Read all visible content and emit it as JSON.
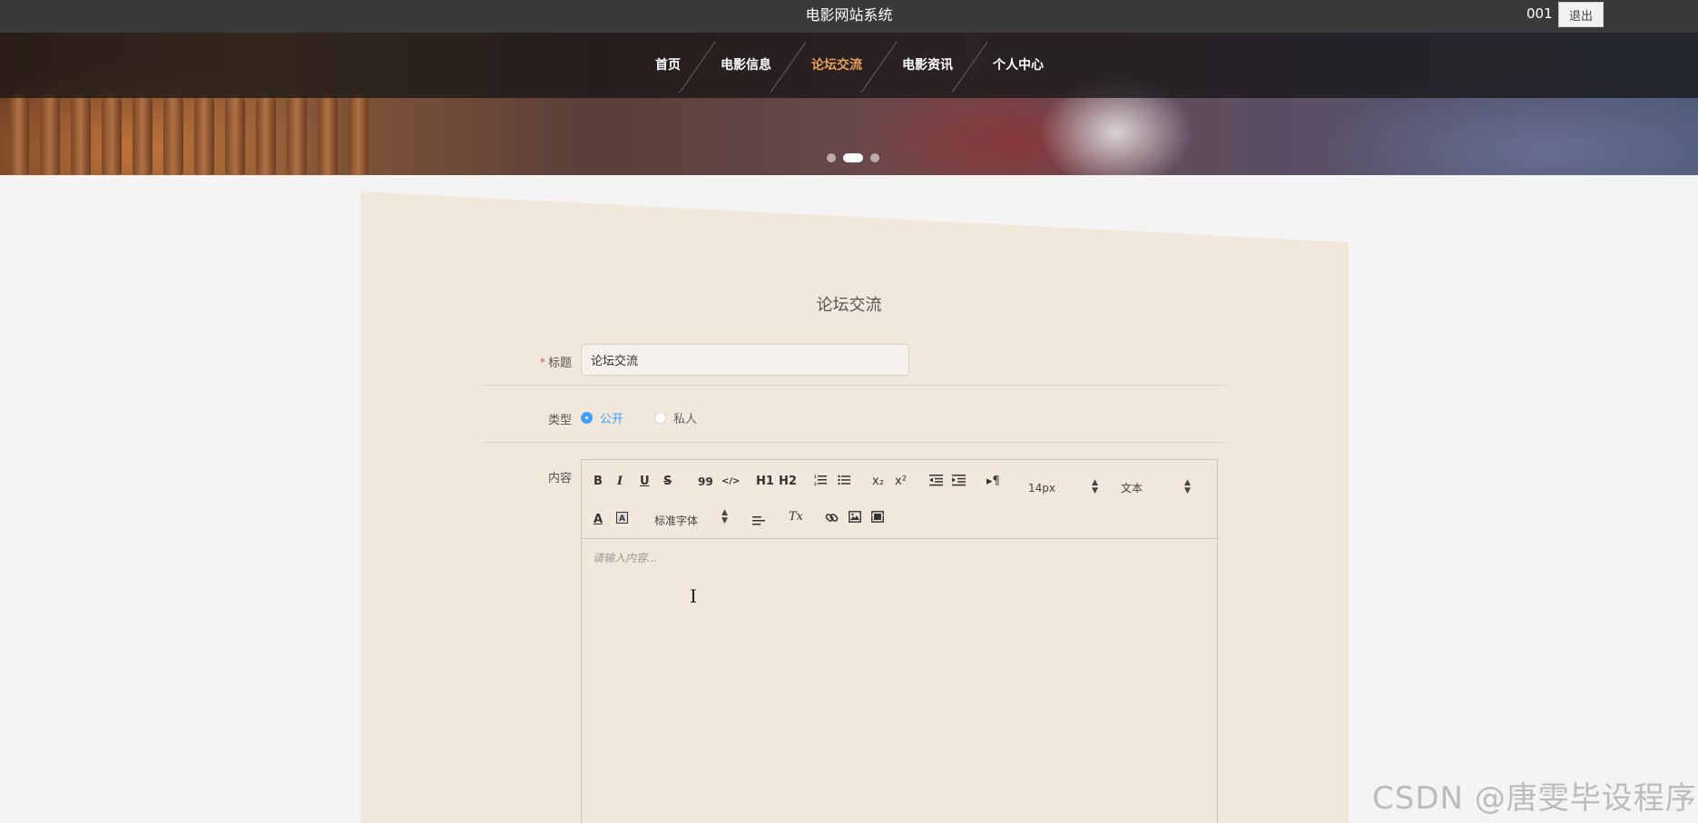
{
  "header": {
    "site_title": "电影网站系统",
    "user_name": "001",
    "logout_label": "退出"
  },
  "nav": {
    "items": [
      {
        "label": "首页"
      },
      {
        "label": "电影信息"
      },
      {
        "label": "论坛交流"
      },
      {
        "label": "电影资讯"
      },
      {
        "label": "个人中心"
      }
    ],
    "active_index": 2
  },
  "carousel": {
    "slide_count": 3,
    "active_slide": 1
  },
  "form": {
    "title": "论坛交流",
    "fields": {
      "title_label": "标题",
      "title_required_mark": "*",
      "title_value": "论坛交流",
      "type_label": "类型",
      "type_options": [
        "公开",
        "私人"
      ],
      "type_selected": "公开",
      "content_label": "内容"
    }
  },
  "editor": {
    "toolbar": {
      "bold": "B",
      "italic": "I",
      "underline": "U",
      "strike": "S",
      "blockquote": "99",
      "code": "</>",
      "h1": "H1",
      "h2": "H2",
      "subscript": "x₂",
      "superscript": "x²",
      "direction": "▸¶",
      "size_value": "14px",
      "header_value": "文本",
      "font_value": "标准字体",
      "clean": "Tx"
    },
    "placeholder": "请输入内容..."
  },
  "watermark": "CSDN @唐雯毕设程序",
  "colors": {
    "topbar": "#3a3a3a",
    "nav_active": "#e8a05a",
    "panel": "#f1e7db",
    "radio_selected": "#409eff",
    "required": "#e05a5a"
  }
}
